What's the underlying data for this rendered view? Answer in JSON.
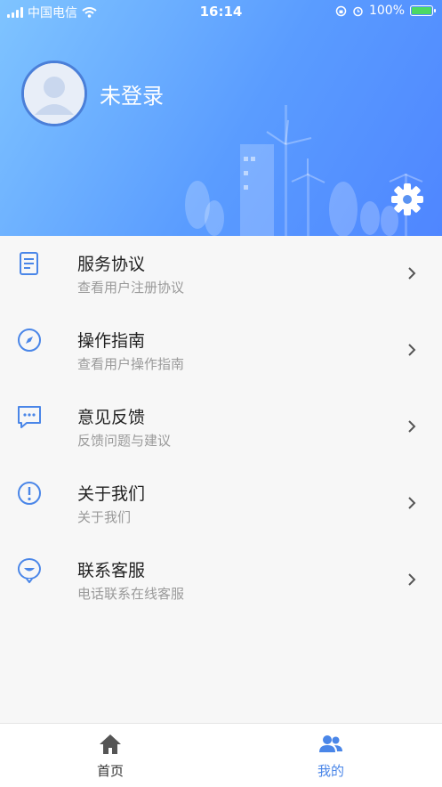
{
  "status": {
    "carrier": "中国电信",
    "time": "16:14",
    "battery": "100%"
  },
  "profile": {
    "username": "未登录"
  },
  "menu": [
    {
      "title": "服务协议",
      "subtitle": "查看用户注册协议",
      "icon": "document-icon"
    },
    {
      "title": "操作指南",
      "subtitle": "查看用户操作指南",
      "icon": "compass-icon"
    },
    {
      "title": "意见反馈",
      "subtitle": "反馈问题与建议",
      "icon": "chat-icon"
    },
    {
      "title": "关于我们",
      "subtitle": "关于我们",
      "icon": "info-icon"
    },
    {
      "title": "联系客服",
      "subtitle": "电话联系在线客服",
      "icon": "support-icon"
    }
  ],
  "tabs": [
    {
      "label": "首页",
      "icon": "home-icon",
      "active": false
    },
    {
      "label": "我的",
      "icon": "users-icon",
      "active": true
    }
  ],
  "colors": {
    "accent": "#4a86e8",
    "header_start": "#7fc4ff",
    "header_end": "#4f86ff"
  }
}
